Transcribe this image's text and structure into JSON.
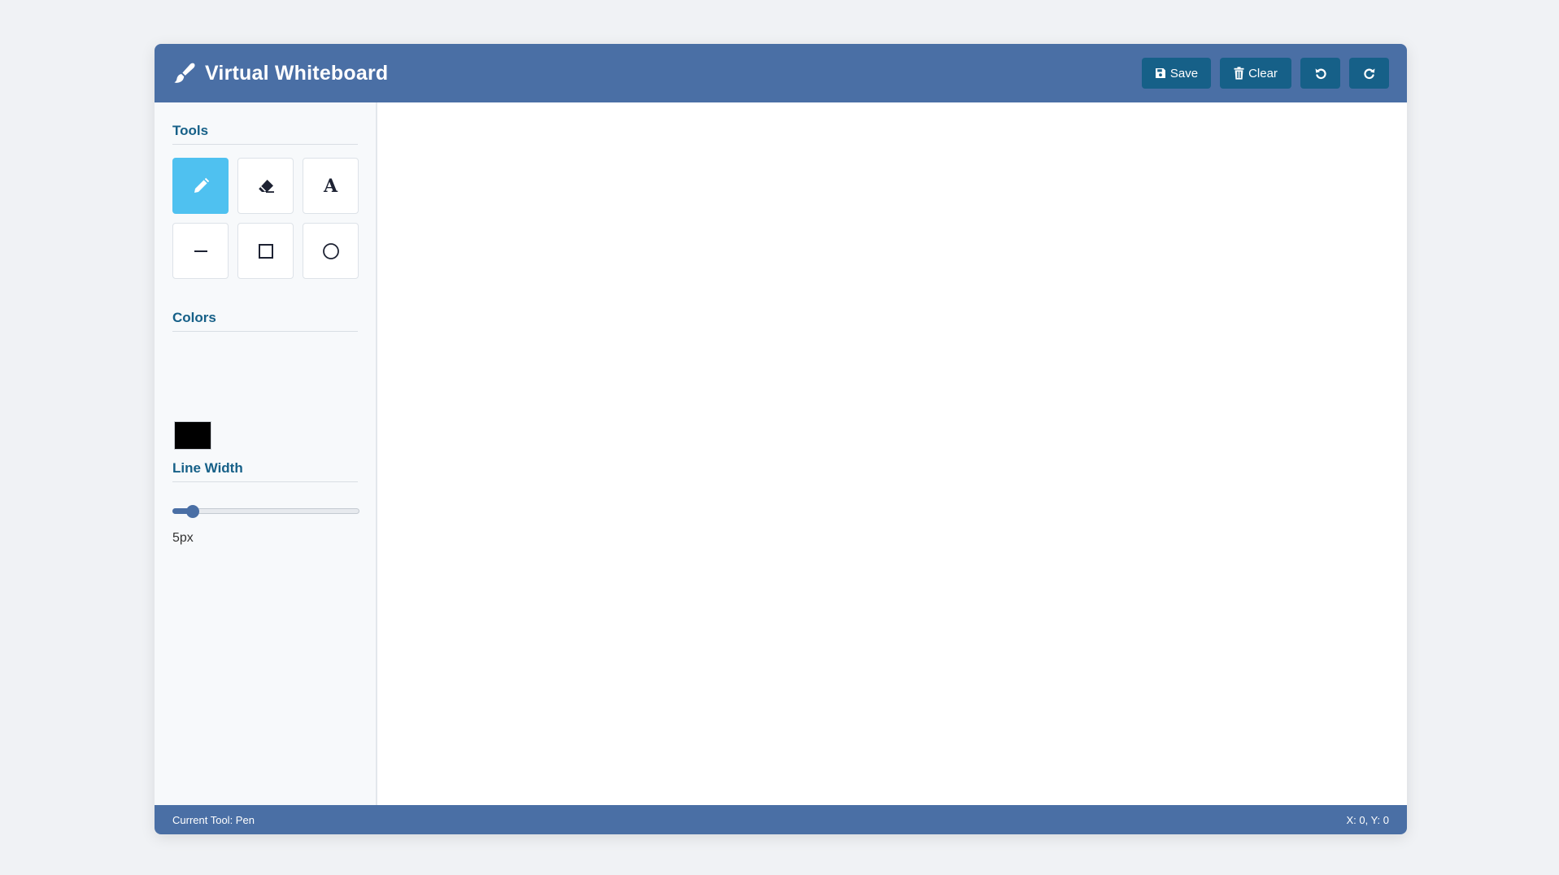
{
  "header": {
    "title": "Virtual Whiteboard",
    "icon": "paint-brush-icon",
    "buttons": [
      {
        "label": "Save",
        "icon": "floppy-disk-icon"
      },
      {
        "label": "Clear",
        "icon": "trash-icon"
      },
      {
        "label": "",
        "icon": "undo-icon"
      },
      {
        "label": "",
        "icon": "redo-icon"
      }
    ]
  },
  "sidebar": {
    "tools_title": "Tools",
    "tools": [
      {
        "name": "pen",
        "icon": "pencil-icon",
        "active": true
      },
      {
        "name": "eraser",
        "icon": "eraser-icon",
        "active": false
      },
      {
        "name": "text",
        "icon": "text-icon",
        "glyph": "A",
        "active": false
      },
      {
        "name": "line",
        "icon": "line-icon",
        "active": false
      },
      {
        "name": "rectangle",
        "icon": "square-icon",
        "active": false
      },
      {
        "name": "circle",
        "icon": "circle-icon",
        "active": false
      }
    ],
    "colors_title": "Colors",
    "selected_color": "#000000",
    "line_width_title": "Line Width",
    "line_width": {
      "value": 5,
      "min": 1,
      "max": 50,
      "display": "5px"
    }
  },
  "status": {
    "current_tool": "Current Tool: Pen",
    "coords": "X: 0, Y: 0"
  },
  "colors": {
    "header_bg": "#4a6fa5",
    "button_bg": "#166088",
    "active_tool": "#4fc1f0",
    "section_title": "#166088"
  }
}
